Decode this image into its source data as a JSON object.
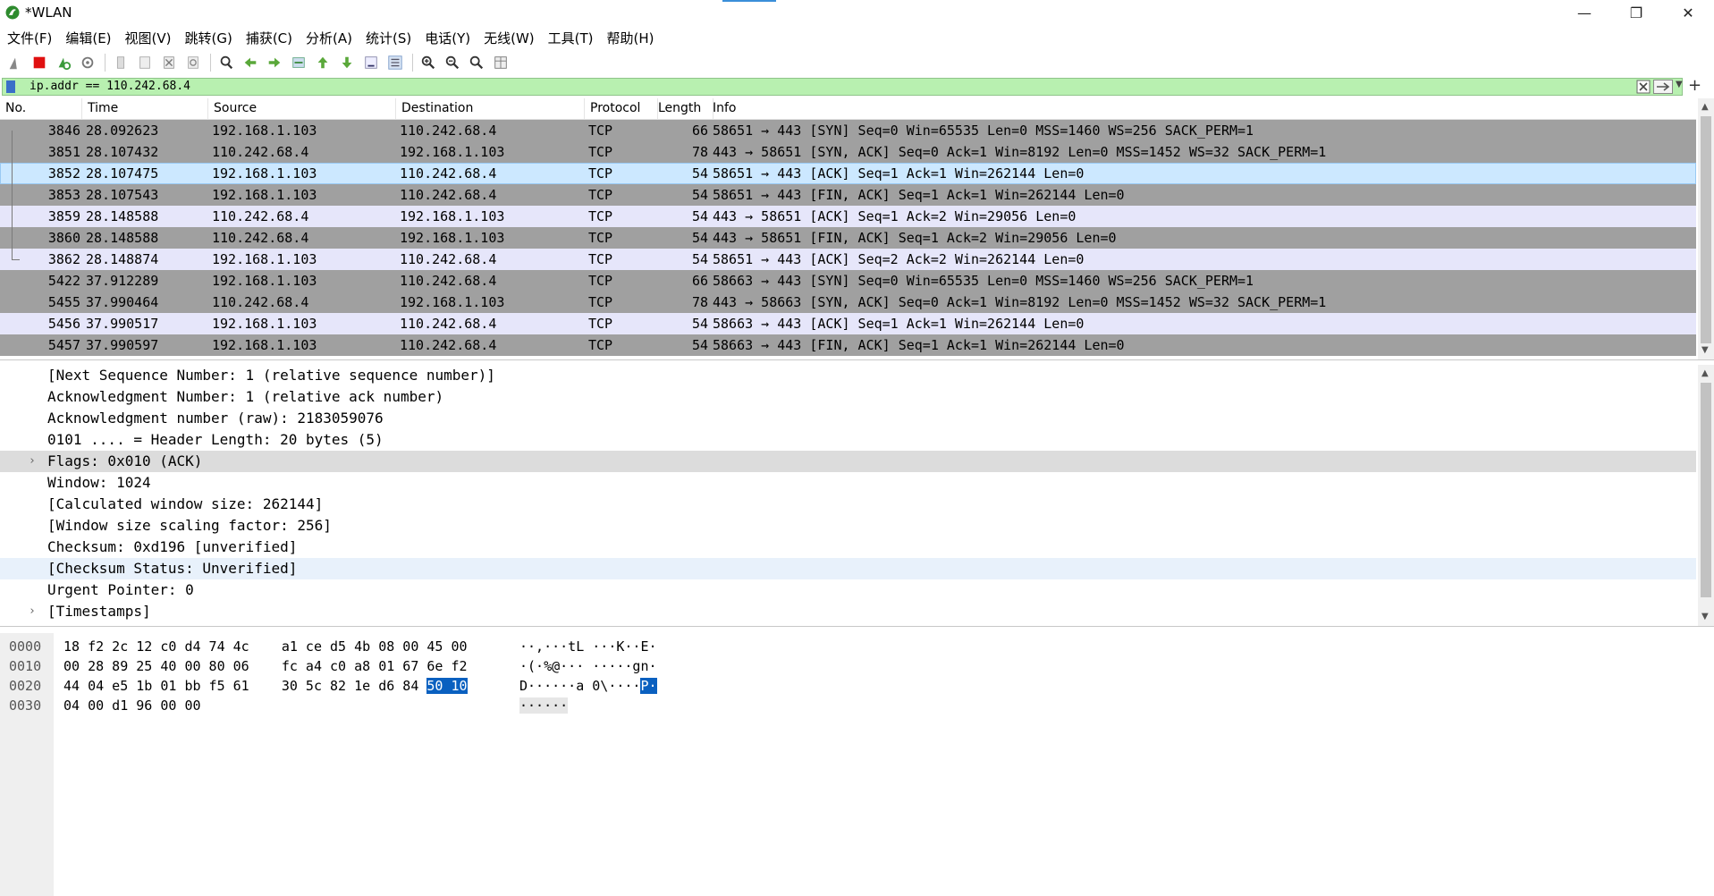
{
  "window": {
    "title": "*WLAN"
  },
  "menu": [
    "文件(F)",
    "编辑(E)",
    "视图(V)",
    "跳转(G)",
    "捕获(C)",
    "分析(A)",
    "统计(S)",
    "电话(Y)",
    "无线(W)",
    "工具(T)",
    "帮助(H)"
  ],
  "toolbar": [
    "shark-fin-start-icon",
    "stop-capture-icon",
    "restart-capture-icon",
    "capture-options-icon",
    "open-file-icon",
    "save-file-icon",
    "close-file-icon",
    "reload-file-icon",
    "find-packet-icon",
    "go-back-icon",
    "go-forward-icon",
    "go-to-packet-icon",
    "go-first-icon",
    "go-last-icon",
    "auto-scroll-icon",
    "colorize-icon",
    "zoom-in-icon",
    "zoom-out-icon",
    "zoom-normal-icon",
    "resize-columns-icon"
  ],
  "filter": {
    "value": "ip.addr == 110.242.68.4"
  },
  "columns": [
    "No.",
    "Time",
    "Source",
    "Destination",
    "Protocol",
    "Length",
    "Info"
  ],
  "packets": [
    {
      "no": "3846",
      "time": "28.092623",
      "src": "192.168.1.103",
      "dst": "110.242.68.4",
      "proto": "TCP",
      "len": "66",
      "info": "58651 → 443 [SYN] Seq=0 Win=65535 Len=0 MSS=1460 WS=256 SACK_PERM=1",
      "style": "gray"
    },
    {
      "no": "3851",
      "time": "28.107432",
      "src": "110.242.68.4",
      "dst": "192.168.1.103",
      "proto": "TCP",
      "len": "78",
      "info": "443 → 58651 [SYN, ACK] Seq=0 Ack=1 Win=8192 Len=0 MSS=1452 WS=32 SACK_PERM=1",
      "style": "gray"
    },
    {
      "no": "3852",
      "time": "28.107475",
      "src": "192.168.1.103",
      "dst": "110.242.68.4",
      "proto": "TCP",
      "len": "54",
      "info": "58651 → 443 [ACK] Seq=1 Ack=1 Win=262144 Len=0",
      "style": "sel"
    },
    {
      "no": "3853",
      "time": "28.107543",
      "src": "192.168.1.103",
      "dst": "110.242.68.4",
      "proto": "TCP",
      "len": "54",
      "info": "58651 → 443 [FIN, ACK] Seq=1 Ack=1 Win=262144 Len=0",
      "style": "gray"
    },
    {
      "no": "3859",
      "time": "28.148588",
      "src": "110.242.68.4",
      "dst": "192.168.1.103",
      "proto": "TCP",
      "len": "54",
      "info": "443 → 58651 [ACK] Seq=1 Ack=2 Win=29056 Len=0",
      "style": "lav"
    },
    {
      "no": "3860",
      "time": "28.148588",
      "src": "110.242.68.4",
      "dst": "192.168.1.103",
      "proto": "TCP",
      "len": "54",
      "info": "443 → 58651 [FIN, ACK] Seq=1 Ack=2 Win=29056 Len=0",
      "style": "gray"
    },
    {
      "no": "3862",
      "time": "28.148874",
      "src": "192.168.1.103",
      "dst": "110.242.68.4",
      "proto": "TCP",
      "len": "54",
      "info": "58651 → 443 [ACK] Seq=2 Ack=2 Win=262144 Len=0",
      "style": "lav"
    },
    {
      "no": "5422",
      "time": "37.912289",
      "src": "192.168.1.103",
      "dst": "110.242.68.4",
      "proto": "TCP",
      "len": "66",
      "info": "58663 → 443 [SYN] Seq=0 Win=65535 Len=0 MSS=1460 WS=256 SACK_PERM=1",
      "style": "gray"
    },
    {
      "no": "5455",
      "time": "37.990464",
      "src": "110.242.68.4",
      "dst": "192.168.1.103",
      "proto": "TCP",
      "len": "78",
      "info": "443 → 58663 [SYN, ACK] Seq=0 Ack=1 Win=8192 Len=0 MSS=1452 WS=32 SACK_PERM=1",
      "style": "gray"
    },
    {
      "no": "5456",
      "time": "37.990517",
      "src": "192.168.1.103",
      "dst": "110.242.68.4",
      "proto": "TCP",
      "len": "54",
      "info": "58663 → 443 [ACK] Seq=1 Ack=1 Win=262144 Len=0",
      "style": "lav"
    },
    {
      "no": "5457",
      "time": "37.990597",
      "src": "192.168.1.103",
      "dst": "110.242.68.4",
      "proto": "TCP",
      "len": "54",
      "info": "58663 → 443 [FIN, ACK] Seq=1 Ack=1 Win=262144 Len=0",
      "style": "gray"
    }
  ],
  "details": [
    {
      "text": "[Next Sequence Number: 1    (relative sequence number)]",
      "expand": false,
      "style": ""
    },
    {
      "text": "Acknowledgment Number: 1    (relative ack number)",
      "expand": false,
      "style": ""
    },
    {
      "text": "Acknowledgment number (raw): 2183059076",
      "expand": false,
      "style": ""
    },
    {
      "text": "0101 .... = Header Length: 20 bytes (5)",
      "expand": false,
      "style": ""
    },
    {
      "text": "Flags: 0x010 (ACK)",
      "expand": true,
      "style": "hl"
    },
    {
      "text": "Window: 1024",
      "expand": false,
      "style": ""
    },
    {
      "text": "[Calculated window size: 262144]",
      "expand": false,
      "style": ""
    },
    {
      "text": "[Window size scaling factor: 256]",
      "expand": false,
      "style": ""
    },
    {
      "text": "Checksum: 0xd196 [unverified]",
      "expand": false,
      "style": ""
    },
    {
      "text": "[Checksum Status: Unverified]",
      "expand": false,
      "style": "sel"
    },
    {
      "text": "Urgent Pointer: 0",
      "expand": false,
      "style": ""
    },
    {
      "text": "[Timestamps]",
      "expand": true,
      "style": ""
    }
  ],
  "bytes": [
    {
      "offset": "0000",
      "hex1": "18 f2 2c 12 c0 d4 74 4c",
      "hex2": "a1 ce d5 4b 08 00 45 00",
      "hexhl": "",
      "ascii": "··,···tL ···K··E·",
      "asciihl": ""
    },
    {
      "offset": "0010",
      "hex1": "00 28 89 25 40 00 80 06",
      "hex2": "fc a4 c0 a8 01 67 6e f2",
      "hexhl": "",
      "ascii": "·(·%@··· ·····gn·",
      "asciihl": ""
    },
    {
      "offset": "0020",
      "hex1": "44 04 e5 1b 01 bb f5 61",
      "hex2": "30 5c 82 1e d6 84 ",
      "hexhl": "50 10",
      "ascii": "D······a 0\\····",
      "asciihl": "P·"
    },
    {
      "offset": "0030",
      "hex1": "04 00 d1 96 00 00",
      "hex2": "",
      "hexhl": "",
      "ascii": "······",
      "asciihl": ""
    }
  ],
  "window_controls": {
    "minimize": "—",
    "maximize": "❐",
    "close": "✕"
  }
}
